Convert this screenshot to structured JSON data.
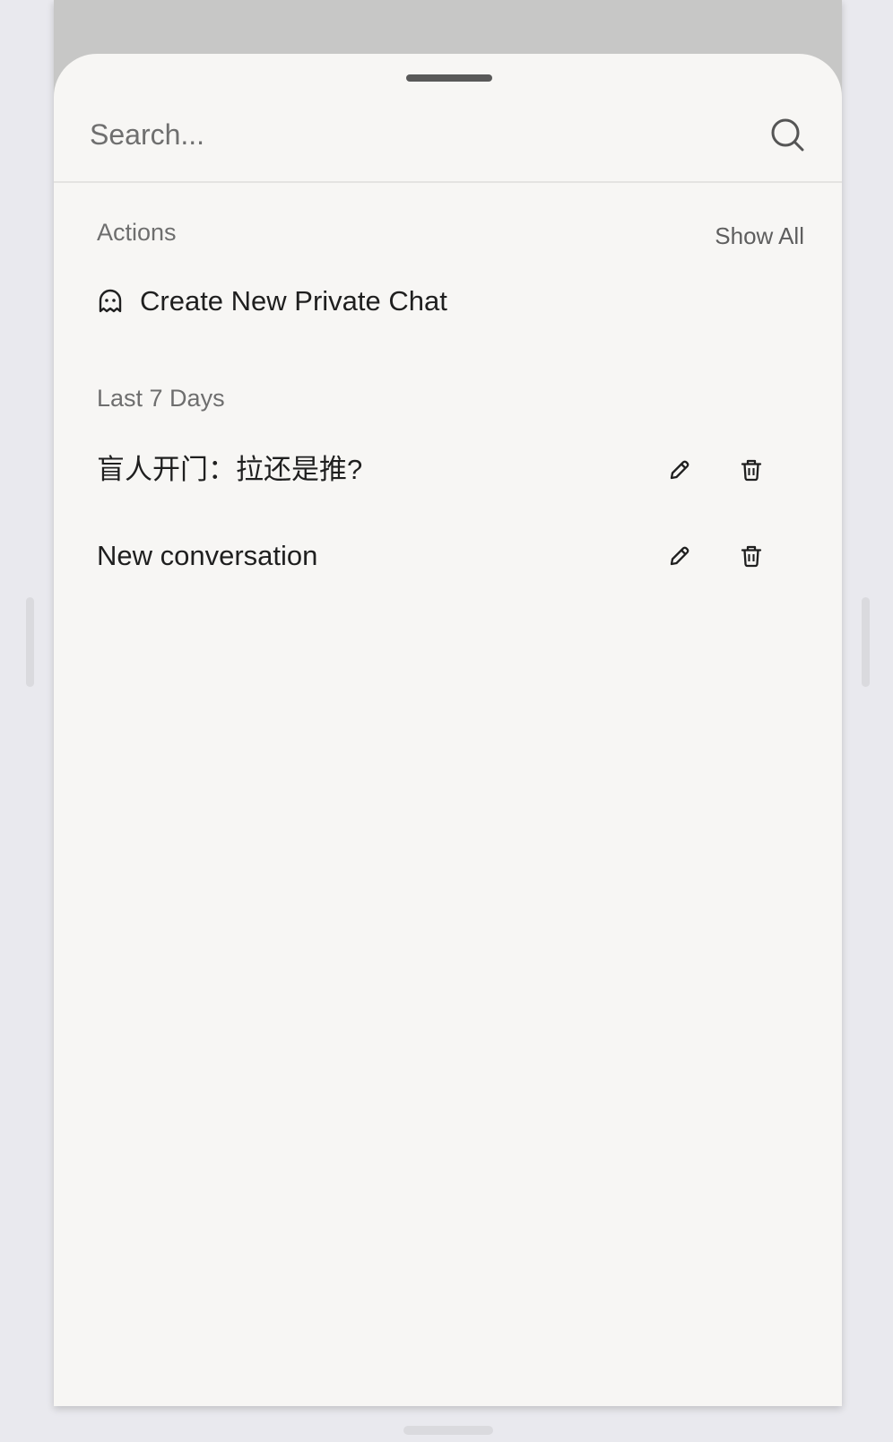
{
  "search": {
    "placeholder": "Search..."
  },
  "actions_section": {
    "label": "Actions",
    "show_all_label": "Show All",
    "items": [
      {
        "label": "Create New Private Chat",
        "icon": "ghost-icon"
      }
    ]
  },
  "history_section": {
    "label": "Last 7 Days",
    "conversations": [
      {
        "title": "盲人开门：拉还是推?"
      },
      {
        "title": "New conversation"
      }
    ]
  },
  "icons": {
    "search": "search-icon",
    "edit": "pencil-icon",
    "delete": "trash-icon"
  },
  "colors": {
    "sheet_background": "#f7f6f4",
    "page_background": "#e9e9ee",
    "dimmed_overlay": "#c7c7c6",
    "primary_text": "#1f1f1f",
    "secondary_text": "#6e6e6e"
  }
}
